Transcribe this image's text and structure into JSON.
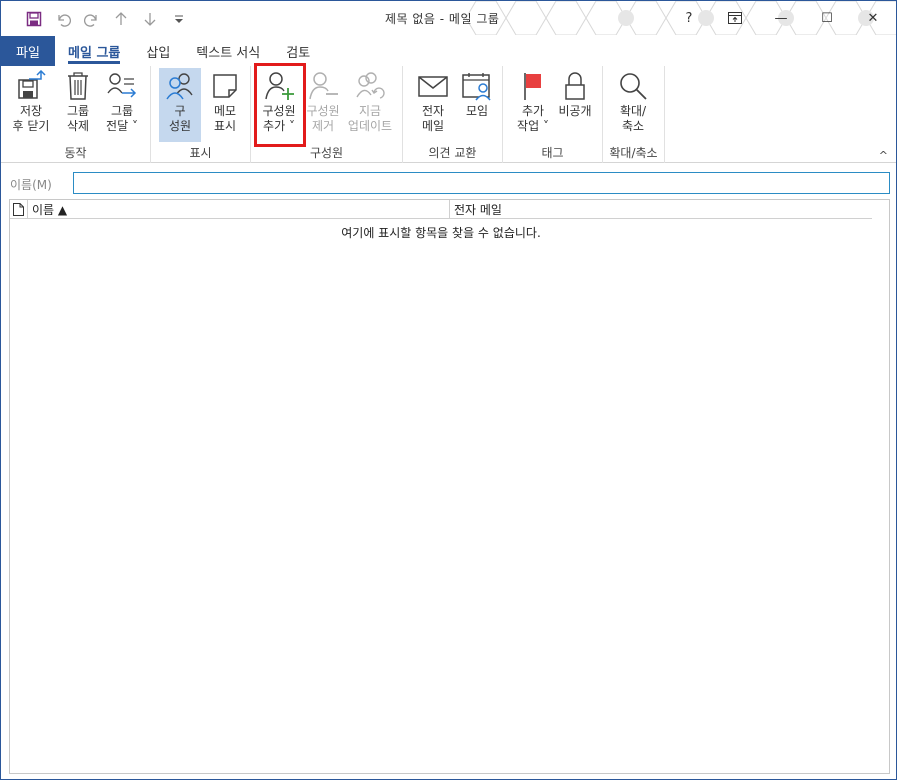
{
  "window": {
    "title": "제목 없음  -  메일 그룹",
    "controls": {
      "help": "?",
      "ribbon_display": "ribbon-display-options",
      "minimize": "—",
      "maximize": "☐",
      "close": "✕"
    }
  },
  "quick_access": [
    "save-icon",
    "undo-icon",
    "redo-icon",
    "previous-icon",
    "next-icon",
    "customize-icon"
  ],
  "tabs": [
    {
      "label": "파일"
    },
    {
      "label": "메일 그룹"
    },
    {
      "label": "삽입"
    },
    {
      "label": "텍스트 서식"
    },
    {
      "label": "검토"
    }
  ],
  "ribbon": {
    "groups": {
      "actions": {
        "label": "동작",
        "save_close": {
          "l1": "저장",
          "l2": "후 닫기"
        },
        "delete_group": {
          "l1": "그룹",
          "l2": "삭제"
        },
        "forward_group": {
          "l1": "그룹",
          "l2": "전달 ˅"
        }
      },
      "show": {
        "label": "표시",
        "members": {
          "l1": "구",
          "l2": "성원"
        },
        "notes": {
          "l1": "메모",
          "l2": "표시"
        }
      },
      "members": {
        "label": "구성원",
        "add_members": {
          "l1": "구성원",
          "l2": "추가 ˅"
        },
        "remove_member": {
          "l1": "구성원",
          "l2": "제거"
        },
        "update_now": {
          "l1": "지금",
          "l2": "업데이트"
        }
      },
      "communicate": {
        "label": "의견 교환",
        "email": {
          "l1": "전자",
          "l2": "메일"
        },
        "meeting": {
          "l1": "모임",
          "l2": ""
        }
      },
      "tags": {
        "label": "태그",
        "follow_up": {
          "l1": "추가",
          "l2": "작업 ˅"
        },
        "private": {
          "l1": "비공개",
          "l2": ""
        }
      },
      "zoom": {
        "label": "확대/축소",
        "zoom": {
          "l1": "확대/",
          "l2": "축소"
        }
      }
    },
    "collapse": "^"
  },
  "name_field": {
    "label": "이름(M)",
    "value": ""
  },
  "list": {
    "headers": {
      "name": "이름 ▲",
      "email": "전자 메일"
    },
    "empty_message": "여기에 표시할 항목을 찾을 수 없습니다."
  },
  "colors": {
    "accent": "#2b579a",
    "highlight": "#e21b1b",
    "add_green": "#3a9a3a",
    "flag_red": "#e84040"
  }
}
